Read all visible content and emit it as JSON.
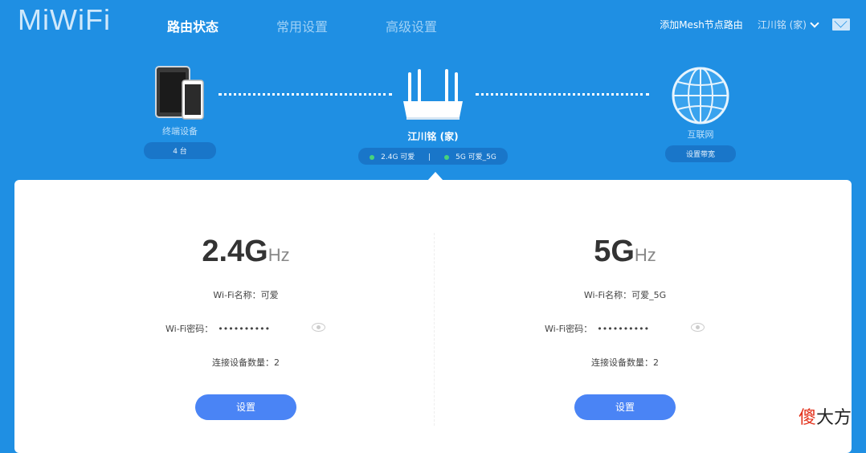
{
  "header": {
    "logo": "MiWiFi",
    "nav": [
      "路由状态",
      "常用设置",
      "高级设置"
    ],
    "mesh": "添加Mesh节点路由",
    "user": "江川铭 (家)"
  },
  "topology": {
    "devices": {
      "label": "终端设备",
      "count": "4 台"
    },
    "router": {
      "name": "江川铭 (家)",
      "band24": "2.4G 可爱",
      "sep": "|",
      "band5": "5G 可爱_5G"
    },
    "internet": {
      "label": "互联网",
      "action": "设置带宽"
    }
  },
  "wifi": [
    {
      "freq": "2.4G",
      "unit": "Hz",
      "name_label": "Wi-Fi名称：",
      "name": "可爱",
      "pwd_label": "Wi-Fi密码：",
      "pwd": "••••••••••",
      "count_label": "连接设备数量：",
      "count": "2",
      "btn": "设置"
    },
    {
      "freq": "5G",
      "unit": "Hz",
      "name_label": "Wi-Fi名称：",
      "name": "可爱_5G",
      "pwd_label": "Wi-Fi密码：",
      "pwd": "••••••••••",
      "count_label": "连接设备数量：",
      "count": "2",
      "btn": "设置"
    }
  ],
  "watermark": {
    "a": "傻",
    "b": "大方"
  },
  "colors": {
    "bg": "#1f8fe3",
    "button": "#4a84f5",
    "online": "#47d37b"
  }
}
